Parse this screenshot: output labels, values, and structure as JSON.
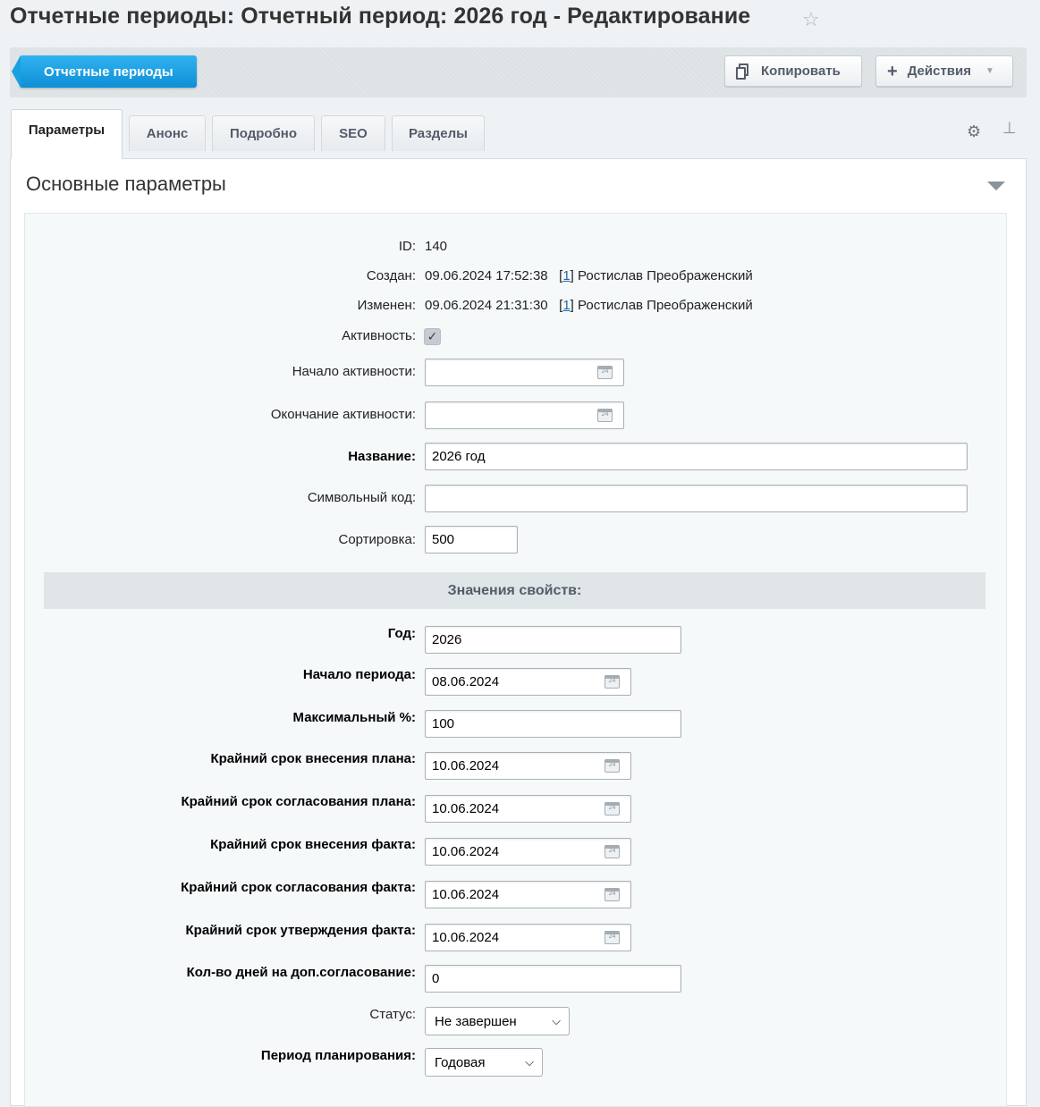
{
  "page": {
    "title": "Отчетные периоды: Отчетный период: 2026 год - Редактирование",
    "favorite_icon": "star-icon"
  },
  "toolbar": {
    "back_label": "Отчетные периоды",
    "copy_label": "Копировать",
    "actions_label": "Действия"
  },
  "tabs": [
    {
      "label": "Параметры",
      "active": true
    },
    {
      "label": "Анонс"
    },
    {
      "label": "Подробно"
    },
    {
      "label": "SEO"
    },
    {
      "label": "Разделы"
    }
  ],
  "section": {
    "title": "Основные параметры"
  },
  "fields": {
    "id": {
      "label": "ID:",
      "value": "140"
    },
    "created": {
      "label": "Создан:",
      "date": "09.06.2024 17:52:38",
      "user_id": "1",
      "user_name": "Ростислав Преображенский"
    },
    "modified": {
      "label": "Изменен:",
      "date": "09.06.2024 21:31:30",
      "user_id": "1",
      "user_name": "Ростислав Преображенский"
    },
    "active": {
      "label": "Активность:",
      "checked": true
    },
    "active_from": {
      "label": "Начало активности:",
      "value": ""
    },
    "active_to": {
      "label": "Окончание активности:",
      "value": ""
    },
    "name": {
      "label": "Название:",
      "value": "2026 год"
    },
    "code": {
      "label": "Символьный код:",
      "value": ""
    },
    "sort": {
      "label": "Сортировка:",
      "value": "500"
    }
  },
  "properties": {
    "header": "Значения свойств:",
    "year": {
      "label": "Год:",
      "value": "2026"
    },
    "period_start": {
      "label": "Начало периода:",
      "value": "08.06.2024"
    },
    "max_percent": {
      "label": "Максимальный %:",
      "value": "100"
    },
    "plan_entry_deadline": {
      "label": "Крайний срок внесения плана:",
      "value": "10.06.2024"
    },
    "plan_approval_deadline": {
      "label": "Крайний срок согласования плана:",
      "value": "10.06.2024"
    },
    "fact_entry_deadline": {
      "label": "Крайний срок внесения факта:",
      "value": "10.06.2024"
    },
    "fact_approval_deadline": {
      "label": "Крайний срок согласования факта:",
      "value": "10.06.2024"
    },
    "fact_confirm_deadline": {
      "label": "Крайний срок утверждения факта:",
      "value": "10.06.2024"
    },
    "extra_days": {
      "label": "Кол-во дней на доп.согласование:",
      "value": "0"
    },
    "status": {
      "label": "Статус:",
      "value": "Не завершен"
    },
    "planning_period": {
      "label": "Период планирования:",
      "value": "Годовая"
    }
  },
  "calendar_icon_text": "24"
}
